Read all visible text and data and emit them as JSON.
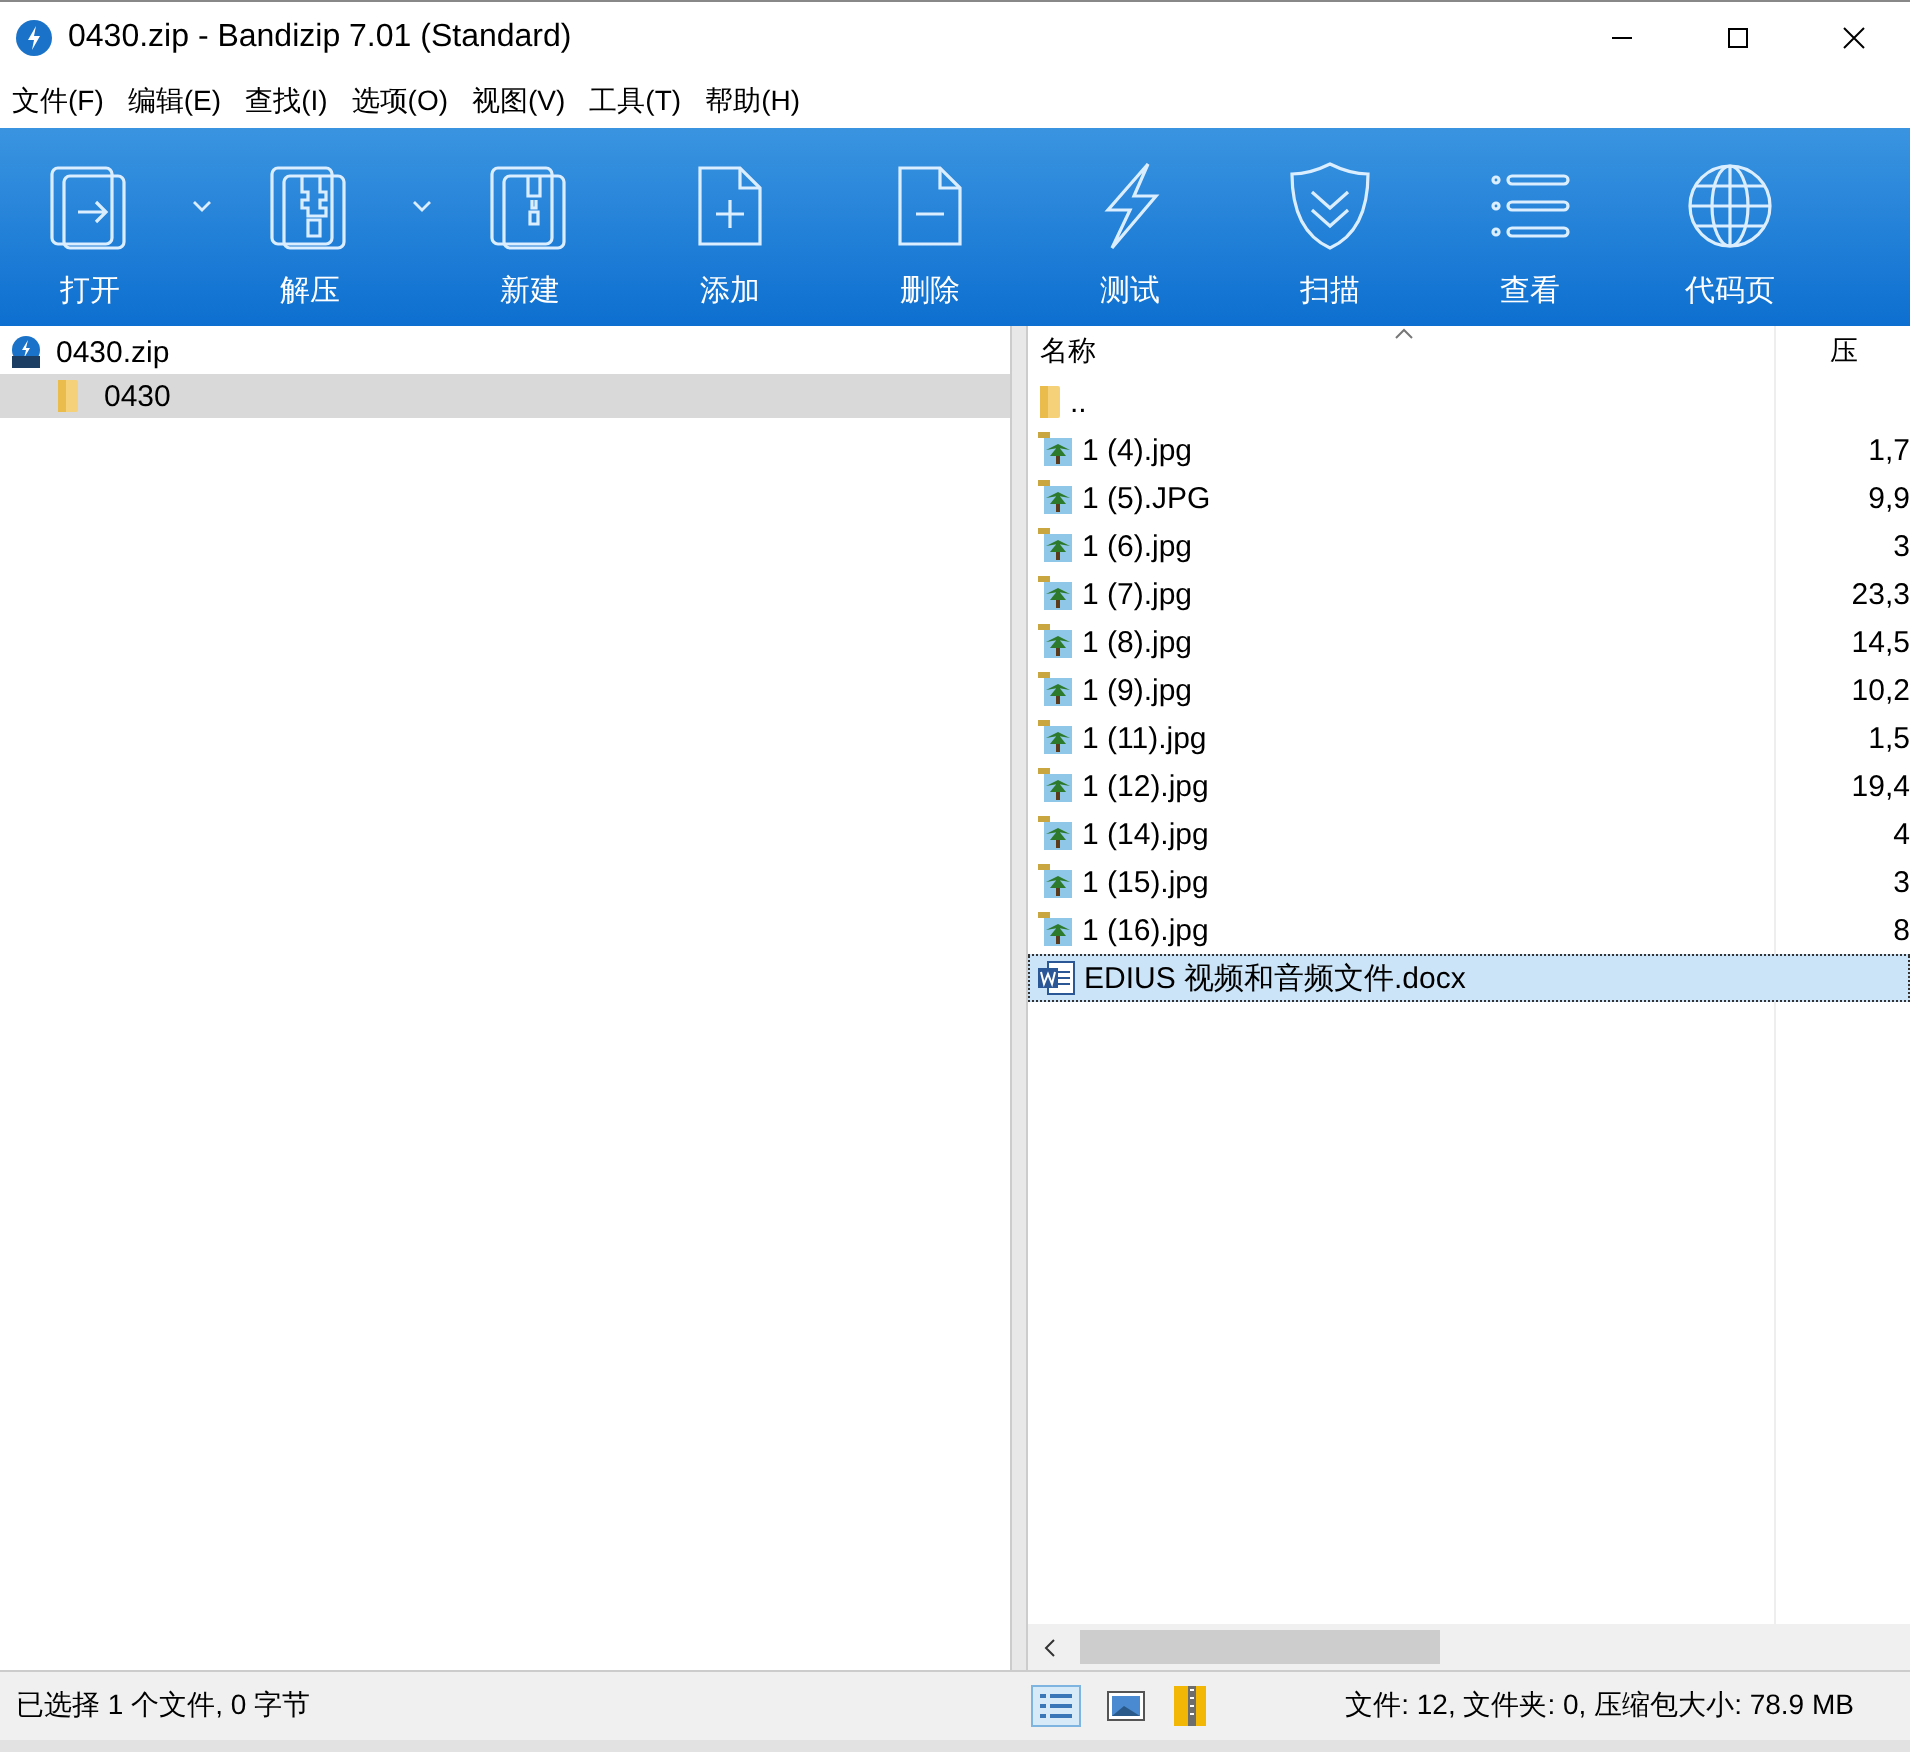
{
  "window": {
    "title": "0430.zip - Bandizip 7.01 (Standard)"
  },
  "menu": [
    "文件(F)",
    "编辑(E)",
    "查找(I)",
    "选项(O)",
    "视图(V)",
    "工具(T)",
    "帮助(H)"
  ],
  "toolbar": [
    {
      "kind": "open",
      "label": "打开",
      "dropdown": true
    },
    {
      "kind": "extract",
      "label": "解压",
      "dropdown": true
    },
    {
      "kind": "new",
      "label": "新建",
      "dropdown": false
    },
    {
      "kind": "add",
      "label": "添加",
      "dropdown": false
    },
    {
      "kind": "delete",
      "label": "删除",
      "dropdown": false
    },
    {
      "kind": "test",
      "label": "测试",
      "dropdown": false
    },
    {
      "kind": "scan",
      "label": "扫描",
      "dropdown": false
    },
    {
      "kind": "view",
      "label": "查看",
      "dropdown": false
    },
    {
      "kind": "codepage",
      "label": "代码页",
      "dropdown": false
    }
  ],
  "tree": {
    "label": "0430.zip",
    "children": [
      {
        "label": "0430",
        "selected": true
      }
    ]
  },
  "file_list": {
    "columns": [
      "名称",
      "压"
    ],
    "rows": [
      {
        "kind": "folder",
        "name": "..",
        "size": "",
        "selected": false
      },
      {
        "kind": "image",
        "name": "1 (4).jpg",
        "size": "1,7",
        "selected": false
      },
      {
        "kind": "image",
        "name": "1 (5).JPG",
        "size": "9,9",
        "selected": false
      },
      {
        "kind": "image",
        "name": "1 (6).jpg",
        "size": "3",
        "selected": false
      },
      {
        "kind": "image",
        "name": "1 (7).jpg",
        "size": "23,3",
        "selected": false
      },
      {
        "kind": "image",
        "name": "1 (8).jpg",
        "size": "14,5",
        "selected": false
      },
      {
        "kind": "image",
        "name": "1 (9).jpg",
        "size": "10,2",
        "selected": false
      },
      {
        "kind": "image",
        "name": "1 (11).jpg",
        "size": "1,5",
        "selected": false
      },
      {
        "kind": "image",
        "name": "1 (12).jpg",
        "size": "19,4",
        "selected": false
      },
      {
        "kind": "image",
        "name": "1 (14).jpg",
        "size": "4",
        "selected": false
      },
      {
        "kind": "image",
        "name": "1 (15).jpg",
        "size": "3",
        "selected": false
      },
      {
        "kind": "image",
        "name": "1 (16).jpg",
        "size": "8",
        "selected": false
      },
      {
        "kind": "document",
        "name": "EDIUS 视频和音频文件.docx",
        "size": "",
        "selected": true
      }
    ]
  },
  "status_bar": {
    "selection": "已选择 1 个文件, 0 字节",
    "summary": "文件: 12, 文件夹: 0, 压缩包大小: 78.9 MB"
  }
}
